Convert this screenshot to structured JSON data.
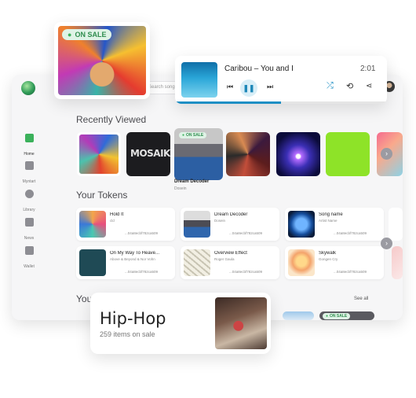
{
  "colors": {
    "accent_green": "#3bb15b",
    "accent_blue": "#1f8fc4"
  },
  "app": {
    "search_placeholder": "Search song",
    "nav": [
      {
        "label": "Home",
        "icon": "home-icon"
      },
      {
        "label": "Myntart",
        "icon": "wallet-card-icon"
      },
      {
        "label": "Library",
        "icon": "library-icon"
      },
      {
        "label": "News",
        "icon": "grid-icon"
      },
      {
        "label": "Wallet",
        "icon": "wallet-icon"
      }
    ],
    "recently_viewed": {
      "title": "Recently Viewed",
      "featured": {
        "badge": "ON SALE",
        "title": "Dream Decoder",
        "artist": "Dosein"
      },
      "mosaik_text": "MOSAIK"
    },
    "tokens": {
      "title": "Your Tokens",
      "items": [
        {
          "name": "Hold It",
          "artist": "cld",
          "hash": "...04a8ecbf782ca509"
        },
        {
          "name": "Dream Decoder",
          "artist": "Dosein",
          "hash": "...04a8ecbf782ca509"
        },
        {
          "name": "Song name",
          "artist": "Artist Name",
          "hash": "...04a8ecbf782ca509"
        },
        {
          "name": "On My Way To Heave...",
          "artist": "Above & Beyond & Nor Vohn",
          "hash": "...04a8ecbf782ca509"
        },
        {
          "name": "Overview Effect",
          "artist": "Roger Gaula",
          "hash": "...04a8ecbf782ca509"
        },
        {
          "name": "Skywalk",
          "artist": "Gongen Cry",
          "hash": "...04a8ecbf782ca509"
        }
      ]
    },
    "third_section": {
      "title_fragment": "You",
      "see_all": "See all",
      "badge": "ON SALE"
    }
  },
  "sale_card": {
    "badge": "ON SALE"
  },
  "player": {
    "track": "Caribou – You and I",
    "time": "2:01",
    "progress": 0.5
  },
  "genre": {
    "title": "Hip-Hop",
    "subtitle": "259 items on sale"
  }
}
